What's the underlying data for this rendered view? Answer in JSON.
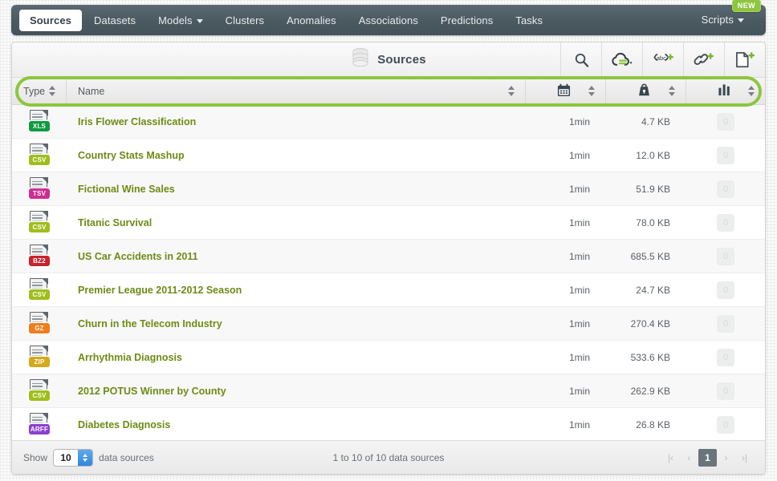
{
  "nav": {
    "items": [
      {
        "label": "Sources",
        "active": true,
        "dropdown": false
      },
      {
        "label": "Datasets",
        "active": false,
        "dropdown": false
      },
      {
        "label": "Models",
        "active": false,
        "dropdown": true
      },
      {
        "label": "Clusters",
        "active": false,
        "dropdown": false
      },
      {
        "label": "Anomalies",
        "active": false,
        "dropdown": false
      },
      {
        "label": "Associations",
        "active": false,
        "dropdown": false
      },
      {
        "label": "Predictions",
        "active": false,
        "dropdown": false
      },
      {
        "label": "Tasks",
        "active": false,
        "dropdown": false
      }
    ],
    "scripts_label": "Scripts",
    "new_badge": "NEW"
  },
  "toolbar": {
    "title": "Sources",
    "db_icon": "database-icon",
    "actions": [
      {
        "name": "search-icon",
        "title": "Search"
      },
      {
        "name": "cloud-upload-icon",
        "title": "Upload source"
      },
      {
        "name": "inline-source-icon",
        "title": "Create inline source"
      },
      {
        "name": "link-source-icon",
        "title": "Create source from URL"
      },
      {
        "name": "new-source-icon",
        "title": "New source"
      }
    ]
  },
  "table": {
    "columns": [
      {
        "key": "type",
        "label": "Type",
        "icon": null,
        "sortable": true
      },
      {
        "key": "name",
        "label": "Name",
        "icon": null,
        "sortable": true
      },
      {
        "key": "date",
        "label": "",
        "icon": "calendar-icon",
        "sortable": true
      },
      {
        "key": "size",
        "label": "",
        "icon": "weight-icon",
        "sortable": true
      },
      {
        "key": "bar",
        "label": "",
        "icon": "bar-chart-icon",
        "sortable": true
      }
    ],
    "rows": [
      {
        "type": "XLS",
        "type_color": "#0f9b3f",
        "name": "Iris Flower Classification",
        "date": "1min",
        "size": "4.7 KB",
        "count": "0"
      },
      {
        "type": "CSV",
        "type_color": "#9fbe1c",
        "name": "Country Stats Mashup",
        "date": "1min",
        "size": "12.0 KB",
        "count": "0"
      },
      {
        "type": "TSV",
        "type_color": "#cf2c91",
        "name": "Fictional Wine Sales",
        "date": "1min",
        "size": "51.9 KB",
        "count": "0"
      },
      {
        "type": "CSV",
        "type_color": "#9fbe1c",
        "name": "Titanic Survival",
        "date": "1min",
        "size": "78.0 KB",
        "count": "0"
      },
      {
        "type": "BZ2",
        "type_color": "#c9232b",
        "name": "US Car Accidents in 2011",
        "date": "1min",
        "size": "685.5 KB",
        "count": "0"
      },
      {
        "type": "CSV",
        "type_color": "#9fbe1c",
        "name": "Premier League 2011-2012 Season",
        "date": "1min",
        "size": "24.7 KB",
        "count": "0"
      },
      {
        "type": "GZ",
        "type_color": "#f07d1b",
        "name": "Churn in the Telecom Industry",
        "date": "1min",
        "size": "270.4 KB",
        "count": "0"
      },
      {
        "type": "ZIP",
        "type_color": "#d4a91a",
        "name": "Arrhythmia Diagnosis",
        "date": "1min",
        "size": "533.6 KB",
        "count": "0"
      },
      {
        "type": "CSV",
        "type_color": "#9fbe1c",
        "name": "2012 POTUS Winner by County",
        "date": "1min",
        "size": "262.9 KB",
        "count": "0"
      },
      {
        "type": "ARFF",
        "type_color": "#8b3fd1",
        "name": "Diabetes Diagnosis",
        "date": "1min",
        "size": "26.8 KB",
        "count": "0"
      }
    ]
  },
  "footer": {
    "show_label": "Show",
    "page_size": "10",
    "unit_label": "data sources",
    "range_text": "1 to 10 of 10 data sources",
    "pager": [
      {
        "glyph": "|‹",
        "name": "first-page-button",
        "active": false
      },
      {
        "glyph": "‹",
        "name": "prev-page-button",
        "active": false
      },
      {
        "glyph": "1",
        "name": "page-1-button",
        "active": true
      },
      {
        "glyph": "›",
        "name": "next-page-button",
        "active": false
      },
      {
        "glyph": "›|",
        "name": "last-page-button",
        "active": false
      }
    ]
  },
  "colors": {
    "accent_green": "#8cc63e",
    "nav_bg": "#4c5a62",
    "link_green": "#6d8b15"
  }
}
